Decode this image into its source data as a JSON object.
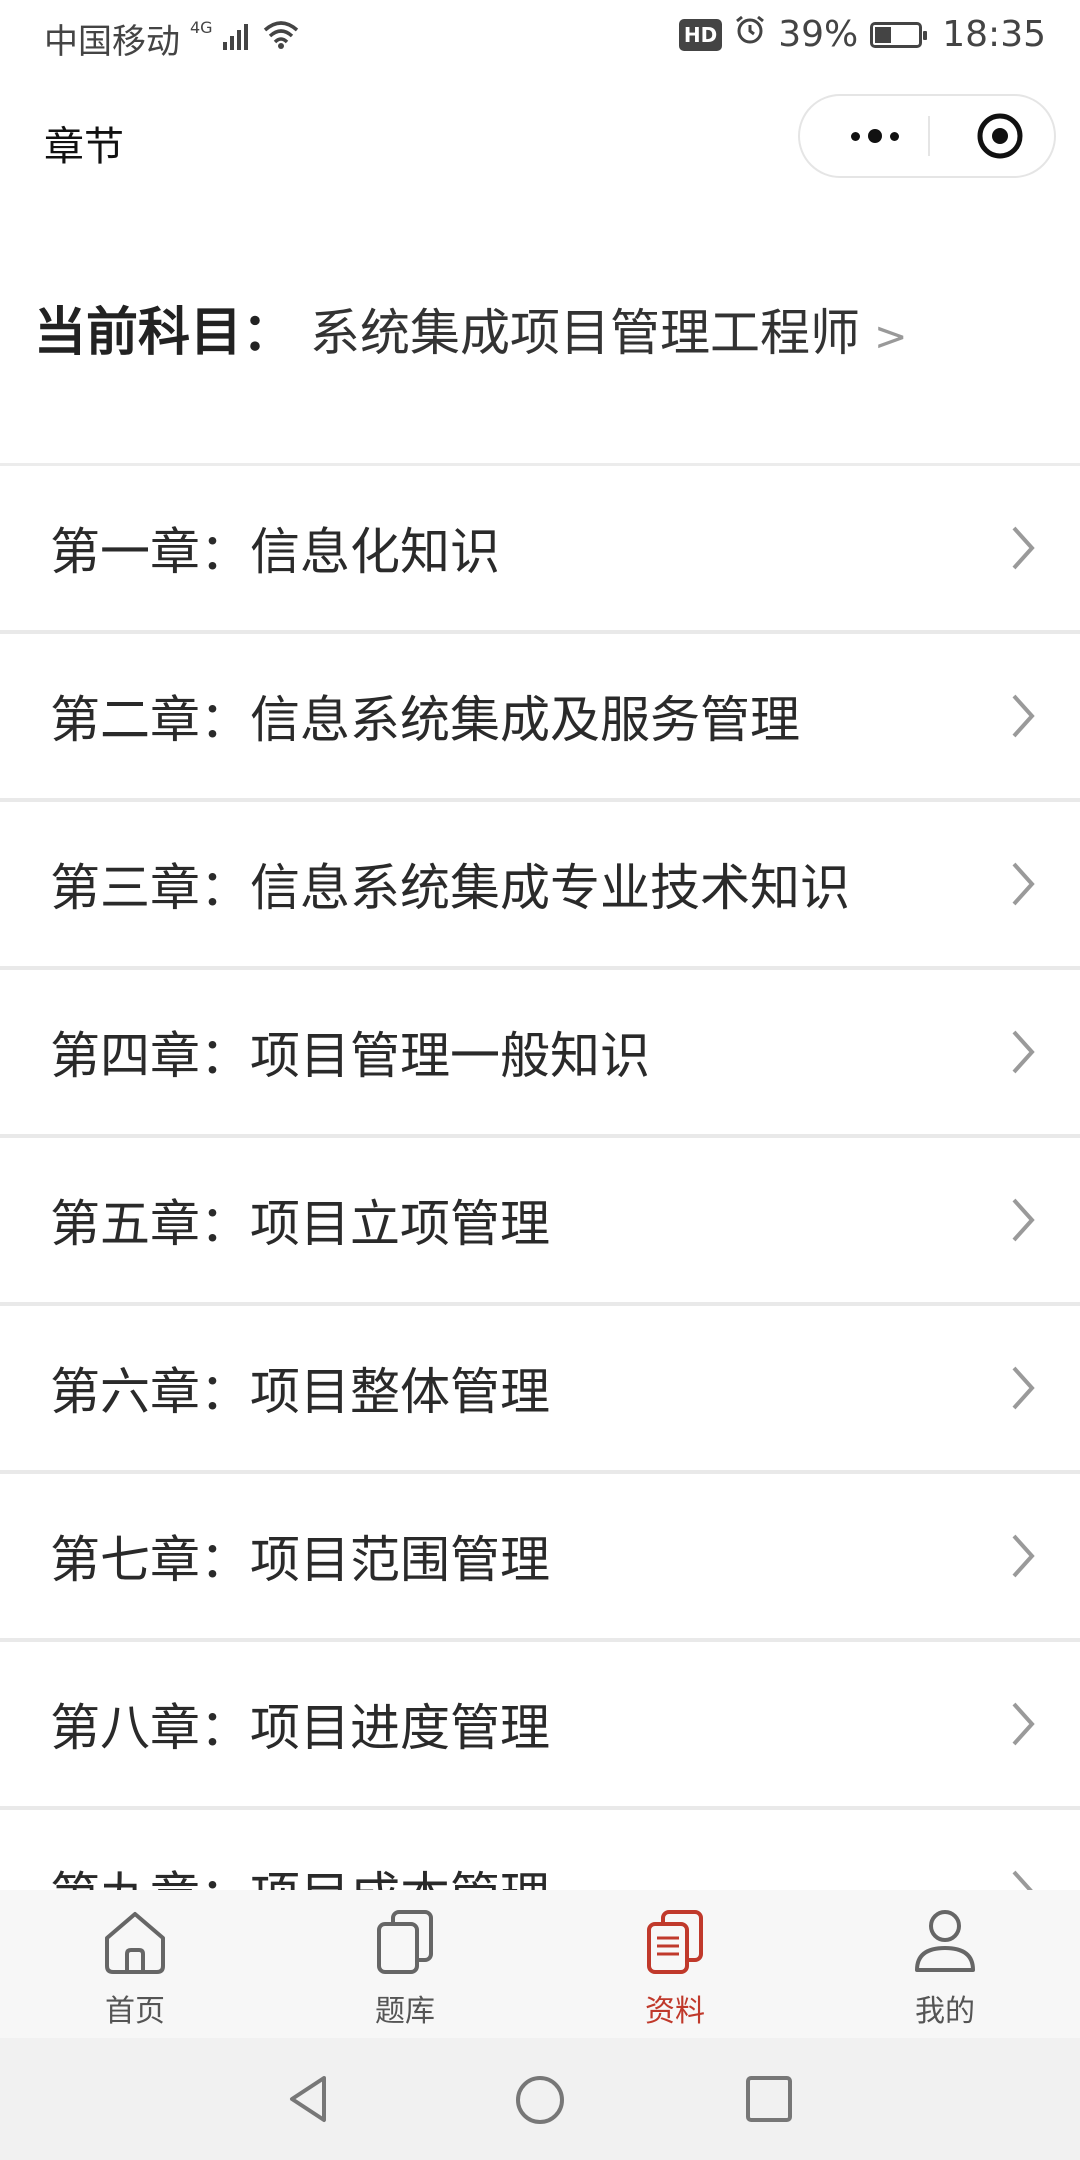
{
  "status_bar": {
    "carrier": "中国移动",
    "network": "4G",
    "hd": "HD",
    "battery_percent": "39%",
    "battery_level": 0.39,
    "time": "18:35"
  },
  "nav": {
    "title": "章节"
  },
  "subject": {
    "label": "当前科目：",
    "name": "系统集成项目管理工程师",
    "arrow": ">"
  },
  "chapters": [
    {
      "label": "第一章：信息化知识"
    },
    {
      "label": "第二章：信息系统集成及服务管理"
    },
    {
      "label": "第三章：信息系统集成专业技术知识"
    },
    {
      "label": "第四章：项目管理一般知识"
    },
    {
      "label": "第五章：项目立项管理"
    },
    {
      "label": "第六章：项目整体管理"
    },
    {
      "label": "第七章：项目范围管理"
    },
    {
      "label": "第八章：项目进度管理"
    },
    {
      "label": "第九章：项目成本管理"
    }
  ],
  "tabs": [
    {
      "label": "首页",
      "icon": "home-icon",
      "active": false
    },
    {
      "label": "题库",
      "icon": "question-bank-icon",
      "active": false
    },
    {
      "label": "资料",
      "icon": "materials-icon",
      "active": true
    },
    {
      "label": "我的",
      "icon": "profile-icon",
      "active": false
    }
  ],
  "colors": {
    "accent": "#c0392b",
    "tab_inactive": "#555555",
    "divider": "#e9e9e9"
  }
}
